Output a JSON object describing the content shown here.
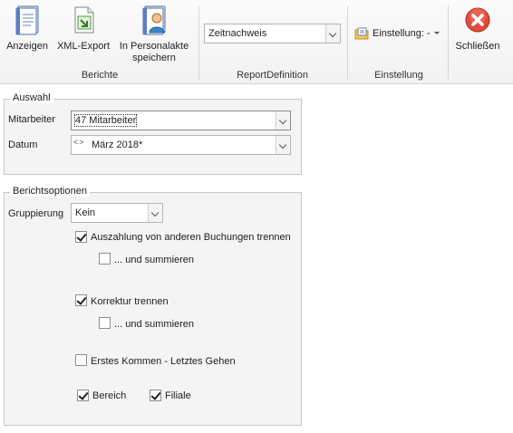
{
  "ribbon": {
    "buttons": {
      "anzeigen": "Anzeigen",
      "xml_export": "XML-Export",
      "personalakte_line1": "In Personalakte",
      "personalakte_line2": "speichern",
      "einstellung": "Einstellung: -",
      "schliessen": "Schließen"
    },
    "groups": {
      "berichte": "Berichte",
      "report_definition": "ReportDefinition",
      "einstellung": "Einstellung"
    },
    "report_combo_value": "Zeitnachweis"
  },
  "auswahl": {
    "title": "Auswahl",
    "mitarbeiter_label": "Mitarbeiter",
    "mitarbeiter_value": "47 Mitarbeiter",
    "datum_label": "Datum",
    "datum_value": "März 2018*"
  },
  "berichtsoptionen": {
    "title": "Berichtsoptionen",
    "gruppierung_label": "Gruppierung",
    "gruppierung_value": "Kein",
    "options": [
      {
        "label": "Auszahlung von anderen Buchungen trennen",
        "checked": true
      },
      {
        "label": "... und summieren",
        "checked": false
      },
      {
        "label": "Korrektur trennen",
        "checked": true
      },
      {
        "label": "... und summieren",
        "checked": false
      },
      {
        "label": "Erstes Kommen - Letztes Gehen",
        "checked": false
      },
      {
        "label": "Bereich",
        "checked": true
      },
      {
        "label": "Filiale",
        "checked": true
      }
    ]
  },
  "colors": {
    "close_red": "#e24a3b",
    "ribbon_bg": "#f4f4f4",
    "group_bg": "#f4f4f4"
  }
}
